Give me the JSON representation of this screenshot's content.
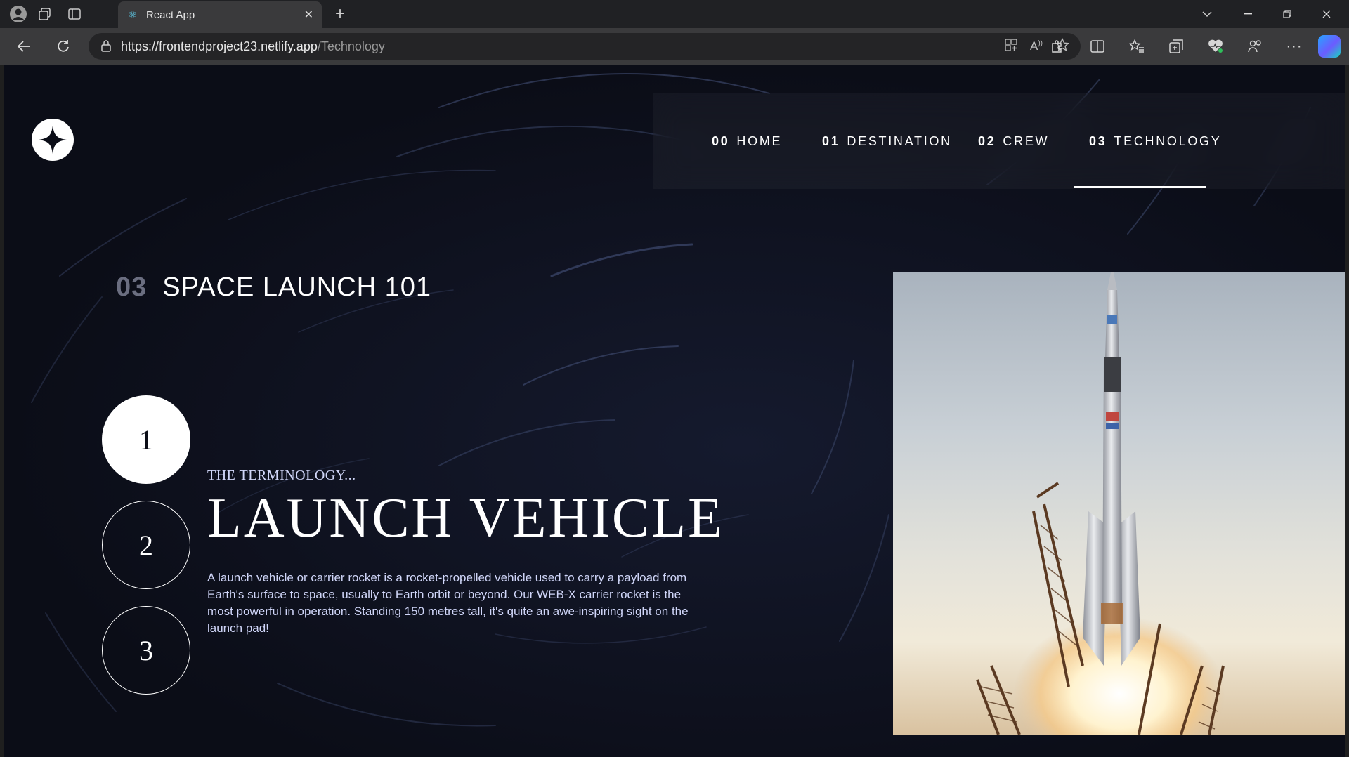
{
  "browser": {
    "tab_title": "React App",
    "url_host": "https://frontendproject23.netlify.app",
    "url_path": "/Technology"
  },
  "nav": {
    "items": [
      {
        "num": "00",
        "label": "HOME"
      },
      {
        "num": "01",
        "label": "DESTINATION"
      },
      {
        "num": "02",
        "label": "CREW"
      },
      {
        "num": "03",
        "label": "TECHNOLOGY"
      }
    ],
    "active_index": 3
  },
  "page": {
    "heading_num": "03",
    "heading_text": "SPACE LAUNCH 101",
    "steps": [
      "1",
      "2",
      "3"
    ],
    "active_step": 0,
    "subtitle": "THE TERMINOLOGY...",
    "title": "LAUNCH VEHICLE",
    "description": "A launch vehicle or carrier rocket is a rocket-propelled vehicle used to carry a payload from Earth's surface to space, usually to Earth orbit or beyond. Our WEB-X carrier rocket is the most powerful in operation. Standing 150 metres tall, it's quite an awe-inspiring sight on the launch pad!"
  },
  "icons": {
    "logo": "star-logo-icon",
    "rocket_image": "rocket-launch-photo"
  },
  "colors": {
    "background": "#0b0d17",
    "accent_text": "#d0d6f9",
    "muted_number": "#6b6e80"
  }
}
